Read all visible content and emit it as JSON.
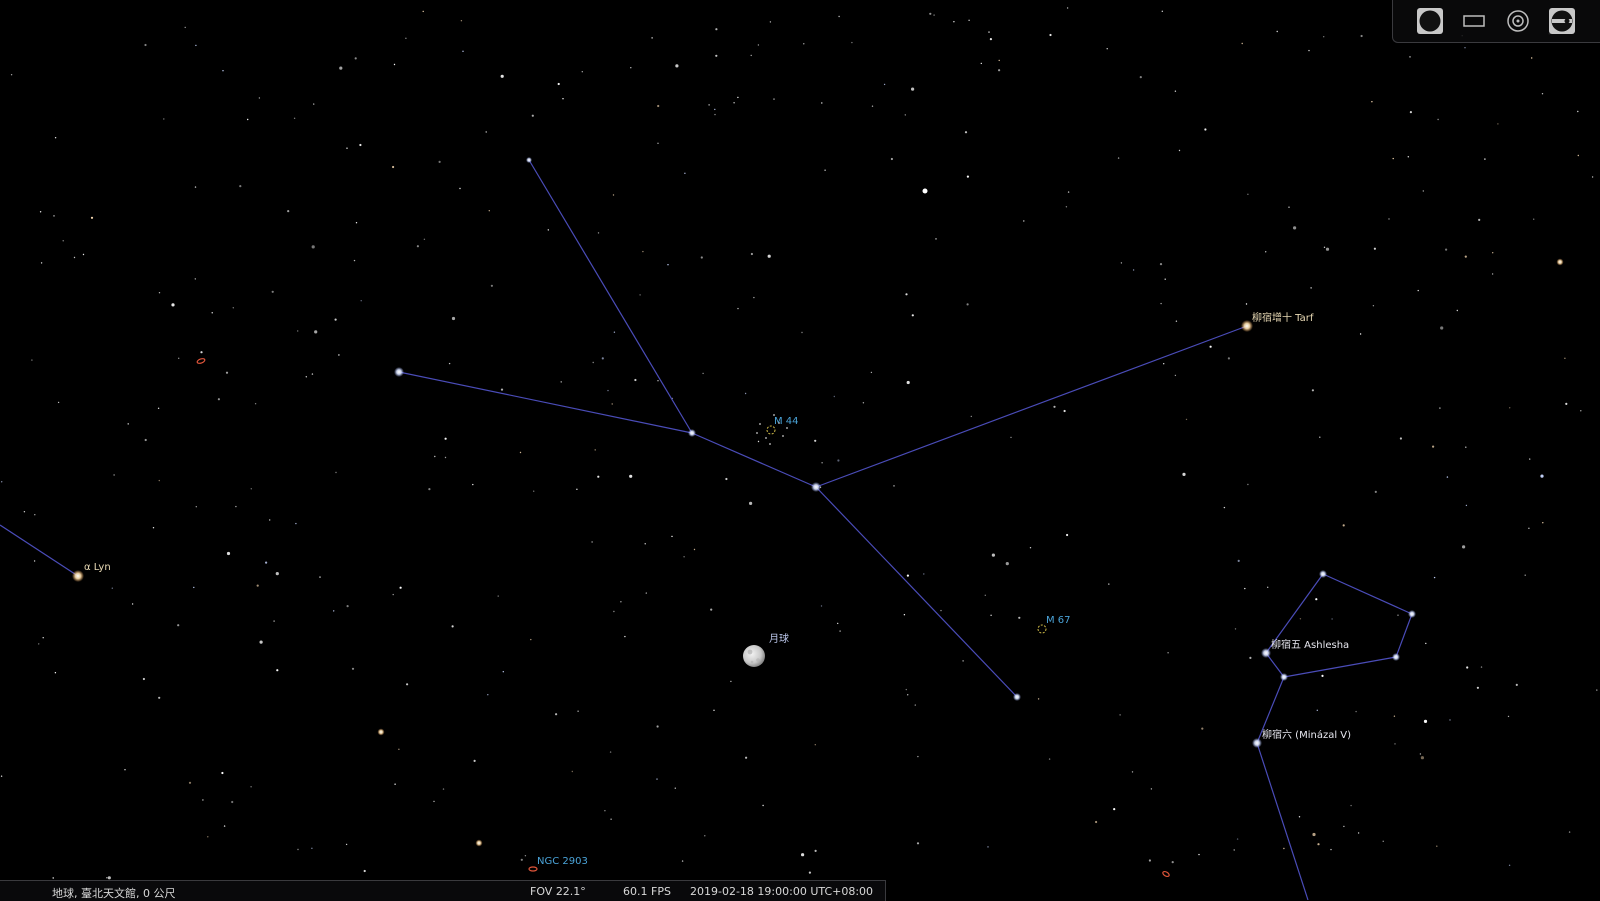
{
  "sky": {
    "background": "#000000",
    "constellation_line_color": "#4a4cb8",
    "labels": {
      "tarf": "柳宿增十 Tarf",
      "m44": "M 44",
      "alpha_lyn": "α Lyn",
      "m67": "M 67",
      "moon": "月球",
      "ashlesha": "柳宿五 Ashlesha",
      "minazal": "柳宿六 (Minázal V)",
      "ngc2903": "NGC 2903"
    }
  },
  "status_bar": {
    "location": "地球, 臺北天文館, 0 公尺",
    "fov": "FOV 22.1°",
    "fps": "60.1 FPS",
    "datetime": "2019-02-18 19:00:00 UTC+08:00"
  },
  "toolbar": {
    "buttons": [
      {
        "name": "dso-symbol-toggle-icon"
      },
      {
        "name": "rectangle-frame-icon"
      },
      {
        "name": "target-ring-icon"
      },
      {
        "name": "ocular-view-icon"
      }
    ]
  }
}
